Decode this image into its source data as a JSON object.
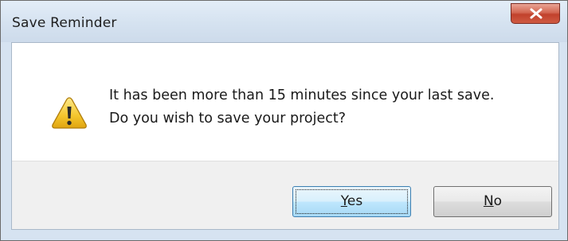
{
  "window": {
    "title": "Save Reminder",
    "close_icon": "close-x-icon"
  },
  "dialog": {
    "icon": "warning-icon",
    "message_line1": "It has been more than 15 minutes since your last save.",
    "message_line2": "Do you wish to save your project?"
  },
  "buttons": {
    "yes": {
      "accel": "Y",
      "rest": "es",
      "default": true
    },
    "no": {
      "accel": "N",
      "rest": "o",
      "default": false
    }
  },
  "colors": {
    "titlebar": "#d6e3f1",
    "close_button": "#c94c36",
    "warning_yellow": "#f4c52c"
  }
}
